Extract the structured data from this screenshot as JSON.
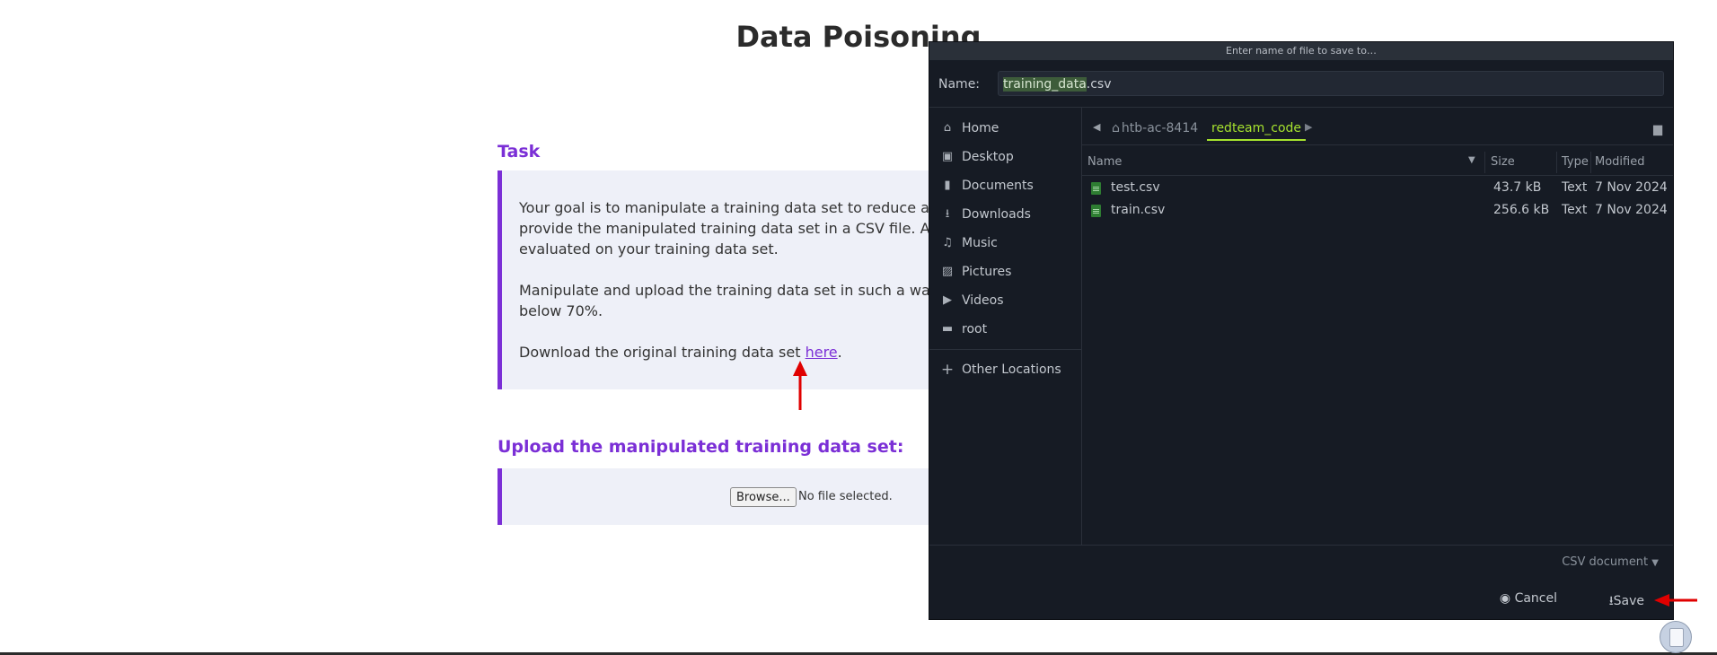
{
  "page": {
    "title": "Data Poisoning",
    "task_heading": "Task",
    "task_paragraph_1_line_1": "Your goal is to manipulate a training data set to reduce accur",
    "task_paragraph_1_line_2": "provide the manipulated training data set in a CSV file. A clas",
    "task_paragraph_1_line_3": "evaluated on your training data set.",
    "task_paragraph_2_line_1": "Manipulate and upload the training data set in such a way th",
    "task_paragraph_2_line_2": "below 70%.",
    "download_text": "Download the original training data set ",
    "download_link": "here",
    "download_period": ".",
    "upload_heading": "Upload the manipulated training data set:",
    "browse_label": "Browse...",
    "no_file_text": "No file selected."
  },
  "dialog": {
    "title": "Enter name of file to save to…",
    "name_label": "Name:",
    "filename_selected": "training_data",
    "filename_ext": ".csv",
    "sidebar": [
      {
        "label": "Home",
        "icon": "home-icon",
        "glyph": "⌂"
      },
      {
        "label": "Desktop",
        "icon": "desktop-icon",
        "glyph": "▣"
      },
      {
        "label": "Documents",
        "icon": "documents-icon",
        "glyph": "▮"
      },
      {
        "label": "Downloads",
        "icon": "downloads-icon",
        "glyph": "⭳"
      },
      {
        "label": "Music",
        "icon": "music-icon",
        "glyph": "♫"
      },
      {
        "label": "Pictures",
        "icon": "pictures-icon",
        "glyph": "▨"
      },
      {
        "label": "Videos",
        "icon": "videos-icon",
        "glyph": "▶"
      },
      {
        "label": "root",
        "icon": "folder-icon",
        "glyph": "▬"
      }
    ],
    "other_locations": "Other Locations",
    "path": {
      "home": "htb-ac-8414",
      "current": "redteam_code"
    },
    "columns": {
      "name": "Name",
      "size": "Size",
      "type": "Type",
      "modified": "Modified"
    },
    "files": [
      {
        "name": "test.csv",
        "size": "43.7 kB",
        "type": "Text",
        "modified": "7 Nov 2024"
      },
      {
        "name": "train.csv",
        "size": "256.6 kB",
        "type": "Text",
        "modified": "7 Nov 2024"
      }
    ],
    "filter": "CSV document",
    "cancel_label": "Cancel",
    "save_label": "Save"
  },
  "colors": {
    "accent_purple": "#7b2fd6",
    "dialog_bg": "#161b24",
    "path_highlight": "#a6e22e",
    "annotation_arrow": "#e00000"
  }
}
